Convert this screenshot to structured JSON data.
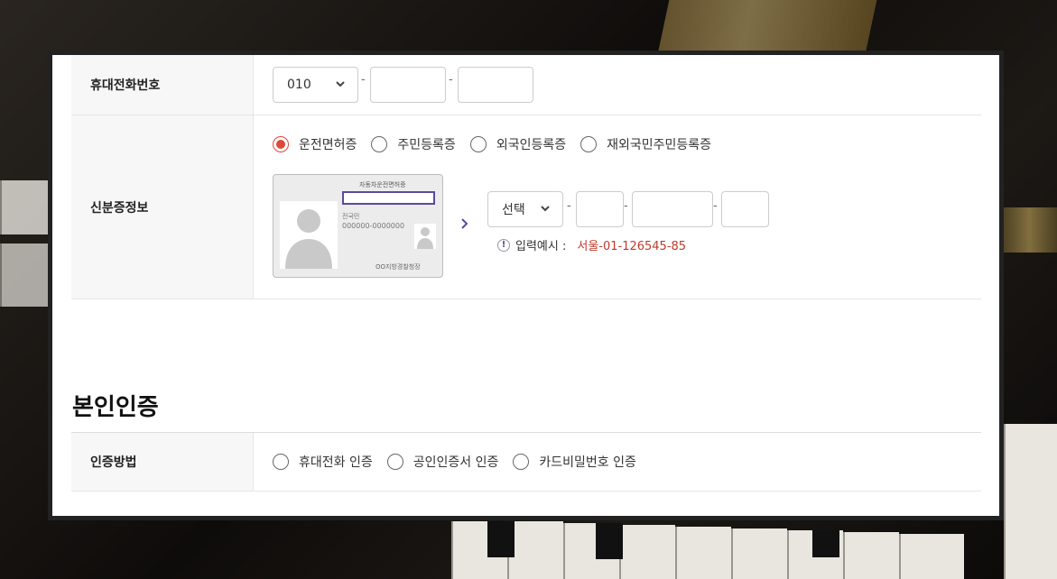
{
  "phone": {
    "label": "휴대전화번호",
    "prefix_value": "010",
    "dash": "-",
    "middle_value": "",
    "last_value": ""
  },
  "id_info": {
    "label": "신분증정보",
    "options": [
      {
        "label": "운전면허증",
        "selected": true
      },
      {
        "label": "주민등록증",
        "selected": false
      },
      {
        "label": "외국인등록증",
        "selected": false
      },
      {
        "label": "재외국민주민등록증",
        "selected": false
      }
    ],
    "card": {
      "title": "자동차운전면허증",
      "name": "전국민",
      "number": "000000-0000000",
      "issuer": "OO지방경찰청장"
    },
    "region_select": "선택",
    "dash": "-",
    "example_icon": "!",
    "example_label": "입력예시 :",
    "example_value": "서울-01-126545-85"
  },
  "verification": {
    "section_title": "본인인증",
    "label": "인증방법",
    "options": [
      {
        "label": "휴대전화 인증",
        "selected": false
      },
      {
        "label": "공인인증서 인증",
        "selected": false
      },
      {
        "label": "카드비밀번호 인증",
        "selected": false
      }
    ]
  },
  "colors": {
    "accent": "#e0483a",
    "highlight": "#5b4a9a",
    "example_text": "#c0392b"
  }
}
